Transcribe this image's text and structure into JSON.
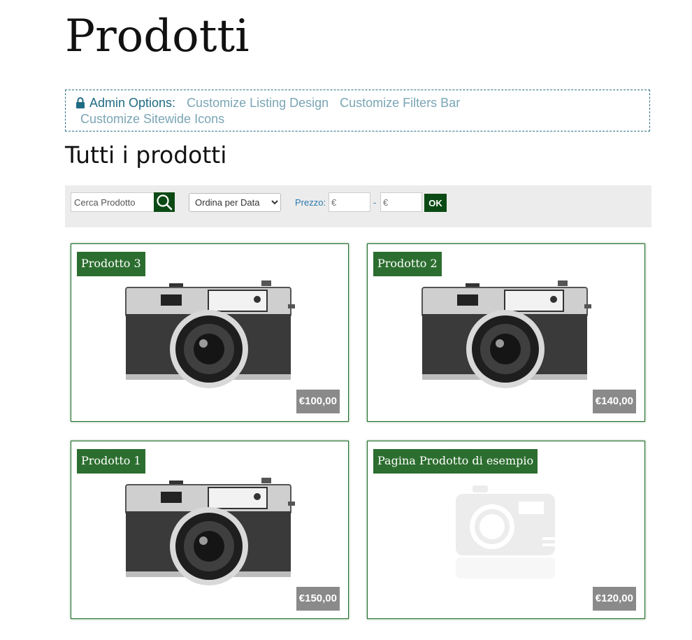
{
  "page": {
    "title": "Prodotti"
  },
  "admin": {
    "label": "Admin Options:",
    "links": [
      "Customize Listing Design",
      "Customize Filters Bar",
      "Customize Sitewide Icons"
    ]
  },
  "section": {
    "title": "Tutti i prodotti"
  },
  "filters": {
    "search_placeholder": "Cerca Prodotto",
    "sort_selected": "Ordina per Data",
    "price_label": "Prezzo:",
    "min_placeholder": "€",
    "max_placeholder": "€",
    "separator": "-",
    "ok_label": "OK"
  },
  "products": [
    {
      "name": "Prodotto 3",
      "price": "€100,00",
      "image": "camera-photo"
    },
    {
      "name": "Prodotto 2",
      "price": "€140,00",
      "image": "camera-photo"
    },
    {
      "name": "Prodotto 1",
      "price": "€150,00",
      "image": "camera-photo"
    },
    {
      "name": "Pagina Prodotto di esempio",
      "price": "€120,00",
      "image": "camera-placeholder-icon"
    }
  ],
  "colors": {
    "accent": "#2c6e2f",
    "dark_green": "#0b4a14",
    "admin_link": "#7aa5b5",
    "price_badge": "#8a8a8a"
  }
}
